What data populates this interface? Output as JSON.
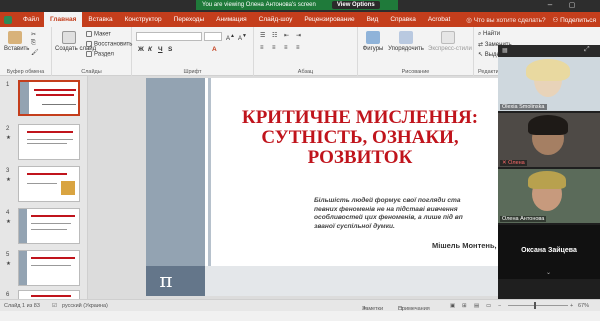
{
  "window": {
    "share_notice": "You are viewing Олена Антонова's screen",
    "view_options": "View Options"
  },
  "ribbon_tabs": [
    "Файл",
    "Главная",
    "Вставка",
    "Конструктор",
    "Переходы",
    "Анимация",
    "Слайд-шоу",
    "Рецензирование",
    "Вид",
    "Справка",
    "Acrobat"
  ],
  "active_tab_index": 1,
  "tell_me": "Что вы хотите сделать?",
  "share_label": "Поделиться",
  "ribbon": {
    "paste": "Вставить",
    "create_slide": "Создать слайд",
    "layout": "Макет",
    "reset": "Восстановить",
    "section": "Раздел",
    "shapes": "Фигуры",
    "arrange": "Упорядочить",
    "quick_styles": "Экспресс-стили",
    "find": "Найти",
    "replace": "Заменить",
    "select": "Выделить",
    "groups": {
      "clipboard": "Буфер обмена",
      "slides": "Слайды",
      "font": "Шрифт",
      "paragraph": "Абзац",
      "drawing": "Рисование",
      "editing": "Редактир..."
    },
    "format": {
      "bold": "Ж",
      "italic": "К",
      "underline": "Ч",
      "strike": "S"
    }
  },
  "thumbnails": [
    {
      "num": "1",
      "star": ""
    },
    {
      "num": "2",
      "star": "★"
    },
    {
      "num": "3",
      "star": "★"
    },
    {
      "num": "4",
      "star": "★"
    },
    {
      "num": "5",
      "star": "★"
    },
    {
      "num": "6",
      "star": ""
    }
  ],
  "slide": {
    "title": "КРИТИЧНЕ МИСЛЕННЯ:\nСУТНІСТЬ, ОЗНАКИ,\nРОЗВИТОК",
    "quote": "Більшість людей формує свої погляди ста\nпевних феноменів не на підставі вивчення\nособливостей цих феноменів, а лише під вп\nзваної суспільної думки.",
    "author": "Мішель Монтень,",
    "pi": "π"
  },
  "participants": [
    {
      "name": "Olexia Smolinska",
      "muted": false
    },
    {
      "name": "Олена",
      "muted": true
    },
    {
      "name": "Олена Антонова",
      "muted": false
    }
  ],
  "active_speaker": "Оксана Зайцева",
  "status": {
    "slide_of": "Слайд 1 из 83",
    "language": "русский (Украина)",
    "notes": "Заметки",
    "comments": "Примечания",
    "zoom": "67%"
  },
  "colors": {
    "accent": "#c43e1c",
    "title_red": "#c0141c",
    "share_green": "#1f7a3a"
  }
}
